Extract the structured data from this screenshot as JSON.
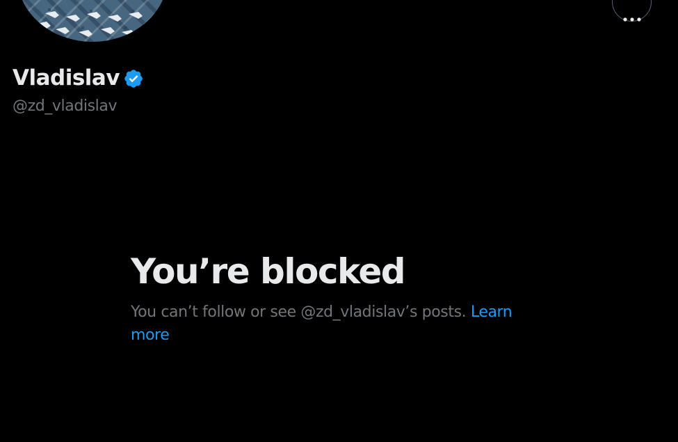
{
  "profile": {
    "display_name": "Vladislav",
    "handle": "@zd_vladislav",
    "verified": true
  },
  "blocked": {
    "title": "You’re blocked",
    "description": "You can’t follow or see @zd_vladislav’s posts.",
    "learn_more": "Learn more"
  },
  "colors": {
    "background": "#000000",
    "primary_text": "#e7e9ea",
    "secondary_text": "#71767b",
    "link": "#1d9bf0",
    "verified_badge": "#1d9bf0",
    "button_border": "#536471"
  },
  "icons": {
    "more": "more-horizontal-icon",
    "verified": "verified-badge-icon"
  }
}
